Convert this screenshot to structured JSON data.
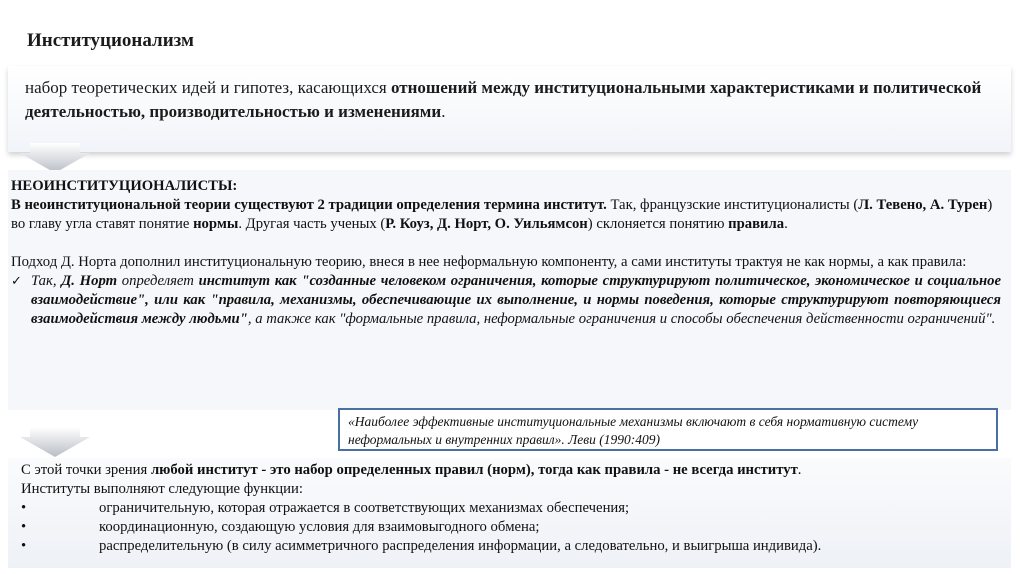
{
  "title": "Институционализм",
  "definition": {
    "prefix": "набор теоретических идей и гипотез, касающихся ",
    "bold": "отношений между институциональными характеристиками и политической деятельностью, производительностью и изменениями",
    "suffix": "."
  },
  "neo": {
    "heading": "НЕОИНСТИТУЦИОНАЛИСТЫ:",
    "p1_b1": "В неоинституциональной теории существуют 2 традиции определения термина институт.",
    "p1_t1": " Так, французские институционалисты (",
    "p1_b2": "Л. Тевено, А. Турен",
    "p1_t2": ") во главу угла ставят понятие ",
    "p1_b3": "нормы",
    "p1_t3": ". Другая часть ученых (",
    "p1_b4": "Р. Коуз, Д. Норт, О. Уильямсон",
    "p1_t4": ") склоняется понятию ",
    "p1_b5": "правила",
    "p1_t5": ".",
    "p2": "Подход Д. Норта дополнил институциональную теорию, внеся в нее неформальную компоненту, а сами институты трактуя не как нормы, а как правила:",
    "check_mark": "✓",
    "q_t1": "Так, ",
    "q_b1": "Д. Норт",
    "q_t2": " определяет ",
    "q_b2": "институт как \"созданные человеком ограничения, которые структурируют политическое, экономическое и социальное взаимодействие\", или как \"правила, механизмы, обеспечивающие их выполнение, и нормы поведения, которые структурируют повторяющиеся взаимодействия между людьми\"",
    "q_t3": ", а также как \"формальные правила, неформальные ограничения и способы обеспечения действенности ограничений\"."
  },
  "quote": "«Наиболее эффективные институциональные механизмы включают в себя нормативную систему неформальных и внутренних правил». Леви (1990:409)",
  "bottom": {
    "i_t1": "С этой точки зрения ",
    "i_b1": "любой институт - это набор определенных правил (норм), тогда как правила - не всегда институт",
    "i_t2": ".",
    "functions_intro": "Институты выполняют следующие функции:",
    "bullet_symbol": "•",
    "functions": [
      "ограничительную, которая отражается в соответствующих механизмах обеспечения;",
      "координационную, создающую условия для взаимовыгодного обмена;",
      "распределительную (в силу асимметричного распределения информации, а следовательно, и выигрыша индивида)."
    ]
  },
  "colors": {
    "quote_border": "#4a6fa5",
    "panel": "#f1f4f9"
  }
}
